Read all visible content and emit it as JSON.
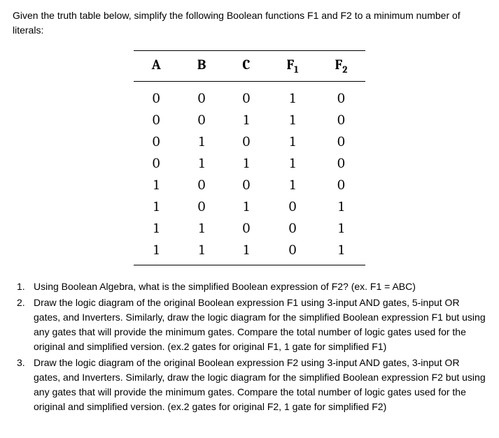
{
  "intro": "Given the truth table below, simplify the following Boolean functions F1 and F2 to a minimum number of literals:",
  "table": {
    "headers": [
      "A",
      "B",
      "C",
      "F",
      "F"
    ],
    "header_subs": [
      "",
      "",
      "",
      "1",
      "2"
    ],
    "rows": [
      [
        "0",
        "0",
        "0",
        "1",
        "0"
      ],
      [
        "0",
        "0",
        "1",
        "1",
        "0"
      ],
      [
        "0",
        "1",
        "0",
        "1",
        "0"
      ],
      [
        "0",
        "1",
        "1",
        "1",
        "0"
      ],
      [
        "1",
        "0",
        "0",
        "1",
        "0"
      ],
      [
        "1",
        "0",
        "1",
        "0",
        "1"
      ],
      [
        "1",
        "1",
        "0",
        "0",
        "1"
      ],
      [
        "1",
        "1",
        "1",
        "0",
        "1"
      ]
    ]
  },
  "questions": [
    {
      "num": "1.",
      "text": "Using Boolean Algebra, what is the simplified Boolean expression of F2? (ex. F1 = ABC)"
    },
    {
      "num": "2.",
      "text": "Draw the logic diagram of the original Boolean expression F1 using 3-input AND gates, 5-input OR gates, and Inverters. Similarly, draw the logic diagram for the simplified Boolean expression F1 but using any gates that will provide the minimum gates. Compare the total number of logic gates used for the original and simplified version. (ex.2 gates for original F1, 1 gate for simplified F1)"
    },
    {
      "num": "3.",
      "text": "Draw the logic diagram of the original Boolean expression F2 using 3-input AND gates, 3-input OR gates, and Inverters. Similarly, draw the logic diagram for the simplified Boolean expression F2 but using any gates that will provide the minimum gates. Compare the total number of logic gates used for the original and simplified version. (ex.2 gates for original F2, 1 gate for simplified F2)"
    }
  ]
}
